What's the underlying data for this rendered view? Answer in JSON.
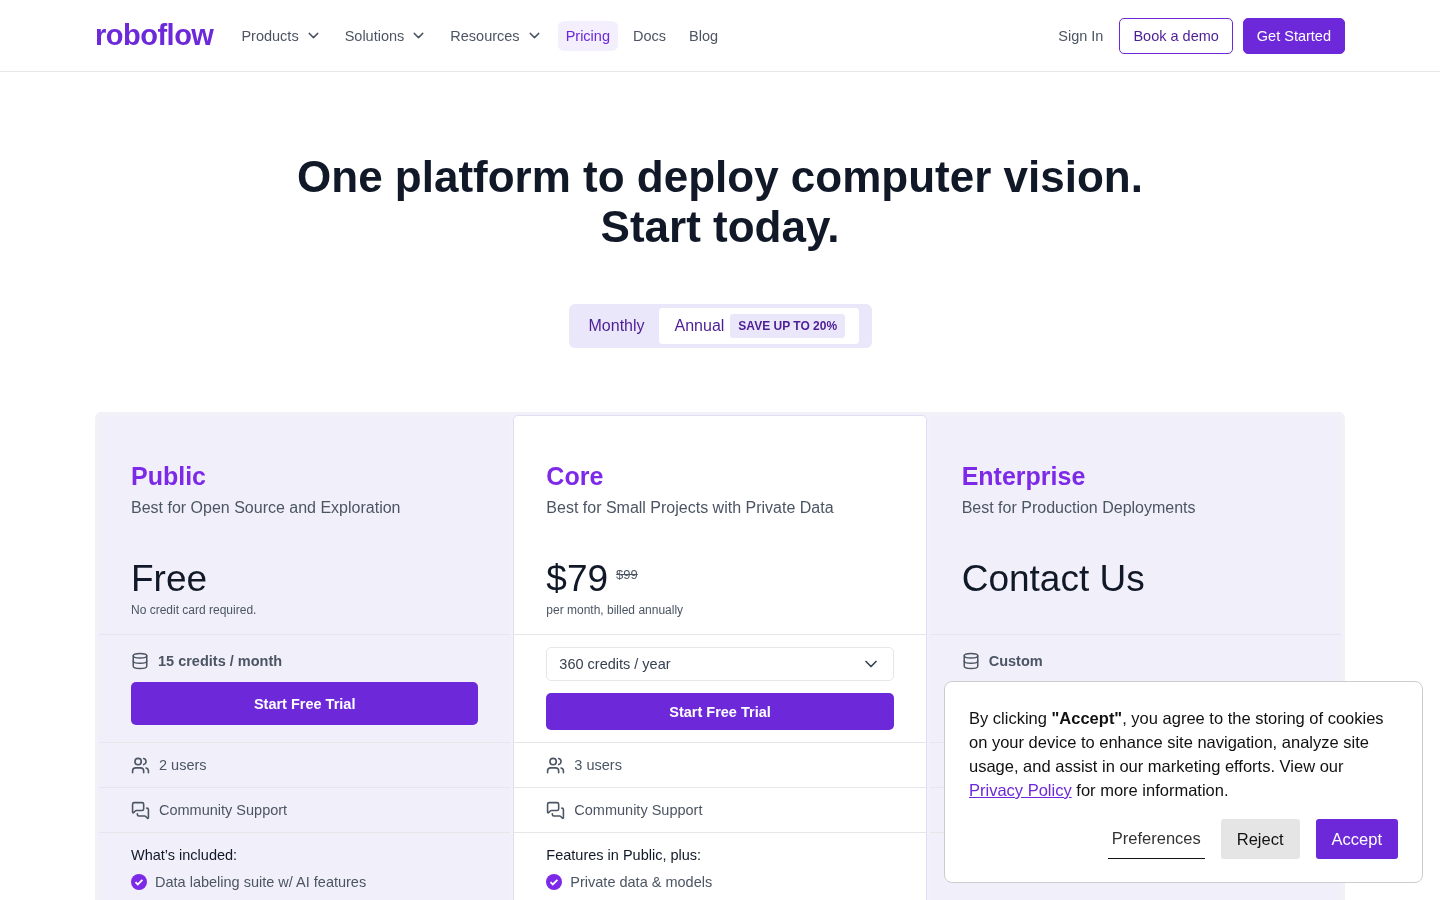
{
  "nav": {
    "logo": "roboflow",
    "links": [
      {
        "label": "Products",
        "dropdown": true,
        "selected": false
      },
      {
        "label": "Solutions",
        "dropdown": true,
        "selected": false
      },
      {
        "label": "Resources",
        "dropdown": true,
        "selected": false
      },
      {
        "label": "Pricing",
        "dropdown": false,
        "selected": true
      },
      {
        "label": "Docs",
        "dropdown": false,
        "selected": false
      },
      {
        "label": "Blog",
        "dropdown": false,
        "selected": false
      }
    ],
    "sign_in": "Sign In",
    "demo": "Book a demo",
    "get_started": "Get Started"
  },
  "hero": {
    "lines": [
      "One platform to deploy computer vision.",
      "Start today."
    ]
  },
  "billing": [
    {
      "label": "Monthly",
      "selected": false
    },
    {
      "label": "Annual",
      "badge": "SAVE UP TO 20%",
      "selected": true
    }
  ],
  "plans": [
    {
      "name": "Public",
      "subtitle": "Best for Open Source and Exploration",
      "price": "Free",
      "note": "No credit card required.",
      "credits": {
        "kind": "text",
        "label": "15 credits / month"
      },
      "button": "Start Free Trial",
      "users": "2 users",
      "support": "Community Support",
      "features_heading": "What’s included:",
      "features": [
        "Data labeling suite w/ AI features"
      ],
      "highlighted": false
    },
    {
      "name": "Core",
      "subtitle": "Best for Small Projects with Private Data",
      "price": "$79",
      "old_price": "$99",
      "note": "per month, billed annually",
      "credits": {
        "kind": "select",
        "label": "360 credits / year"
      },
      "button": "Start Free Trial",
      "users": "3 users",
      "support": "Community Support",
      "features_heading": "Features in Public, plus:",
      "features": [
        "Private data & models"
      ],
      "highlighted": true
    },
    {
      "name": "Enterprise",
      "subtitle": "Best for Production Deployments",
      "price": "Contact Us",
      "credits": {
        "kind": "text",
        "label": "Custom"
      },
      "highlighted": false
    }
  ],
  "cookie_banner": {
    "text": "By clicking **\"Accept\"**, you agree to the storing of cookies on your device to enhance site navigation, analyze site usage, and assist in our marketing efforts. View our",
    "link": "Privacy Policy",
    "text_after": "for more information.",
    "buttons": [
      {
        "label": "Preferences",
        "kind": "link"
      },
      {
        "label": "Reject",
        "kind": "secondary"
      },
      {
        "label": "Accept",
        "kind": "primary"
      }
    ]
  }
}
